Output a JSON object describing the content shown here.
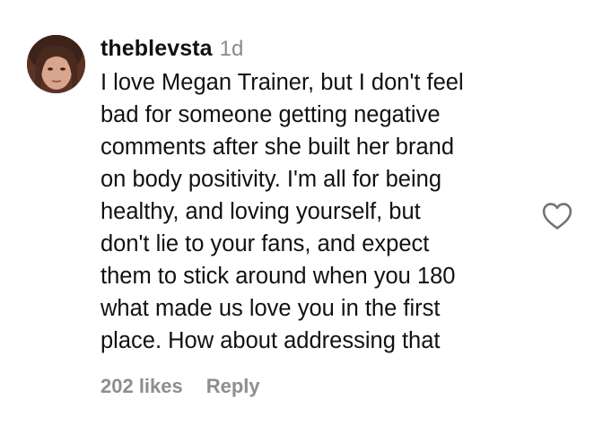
{
  "comment": {
    "username": "theblevsta",
    "timestamp": "1d",
    "text_lines": [
      "I love Megan Trainer, but I don't feel",
      "bad for someone getting negative",
      "comments after she built her brand",
      "on body positivity. I'm all for being",
      "healthy, and loving yourself, but",
      "don't lie to your fans, and expect",
      "them to stick around when you 180",
      "what made us love you in the first",
      "place. How about addressing that"
    ],
    "likes": "202 likes",
    "reply_label": "Reply",
    "like_icon": "heart-outline-icon"
  },
  "colors": {
    "text": "#111111",
    "muted": "#8e8e8e",
    "background": "#ffffff"
  }
}
